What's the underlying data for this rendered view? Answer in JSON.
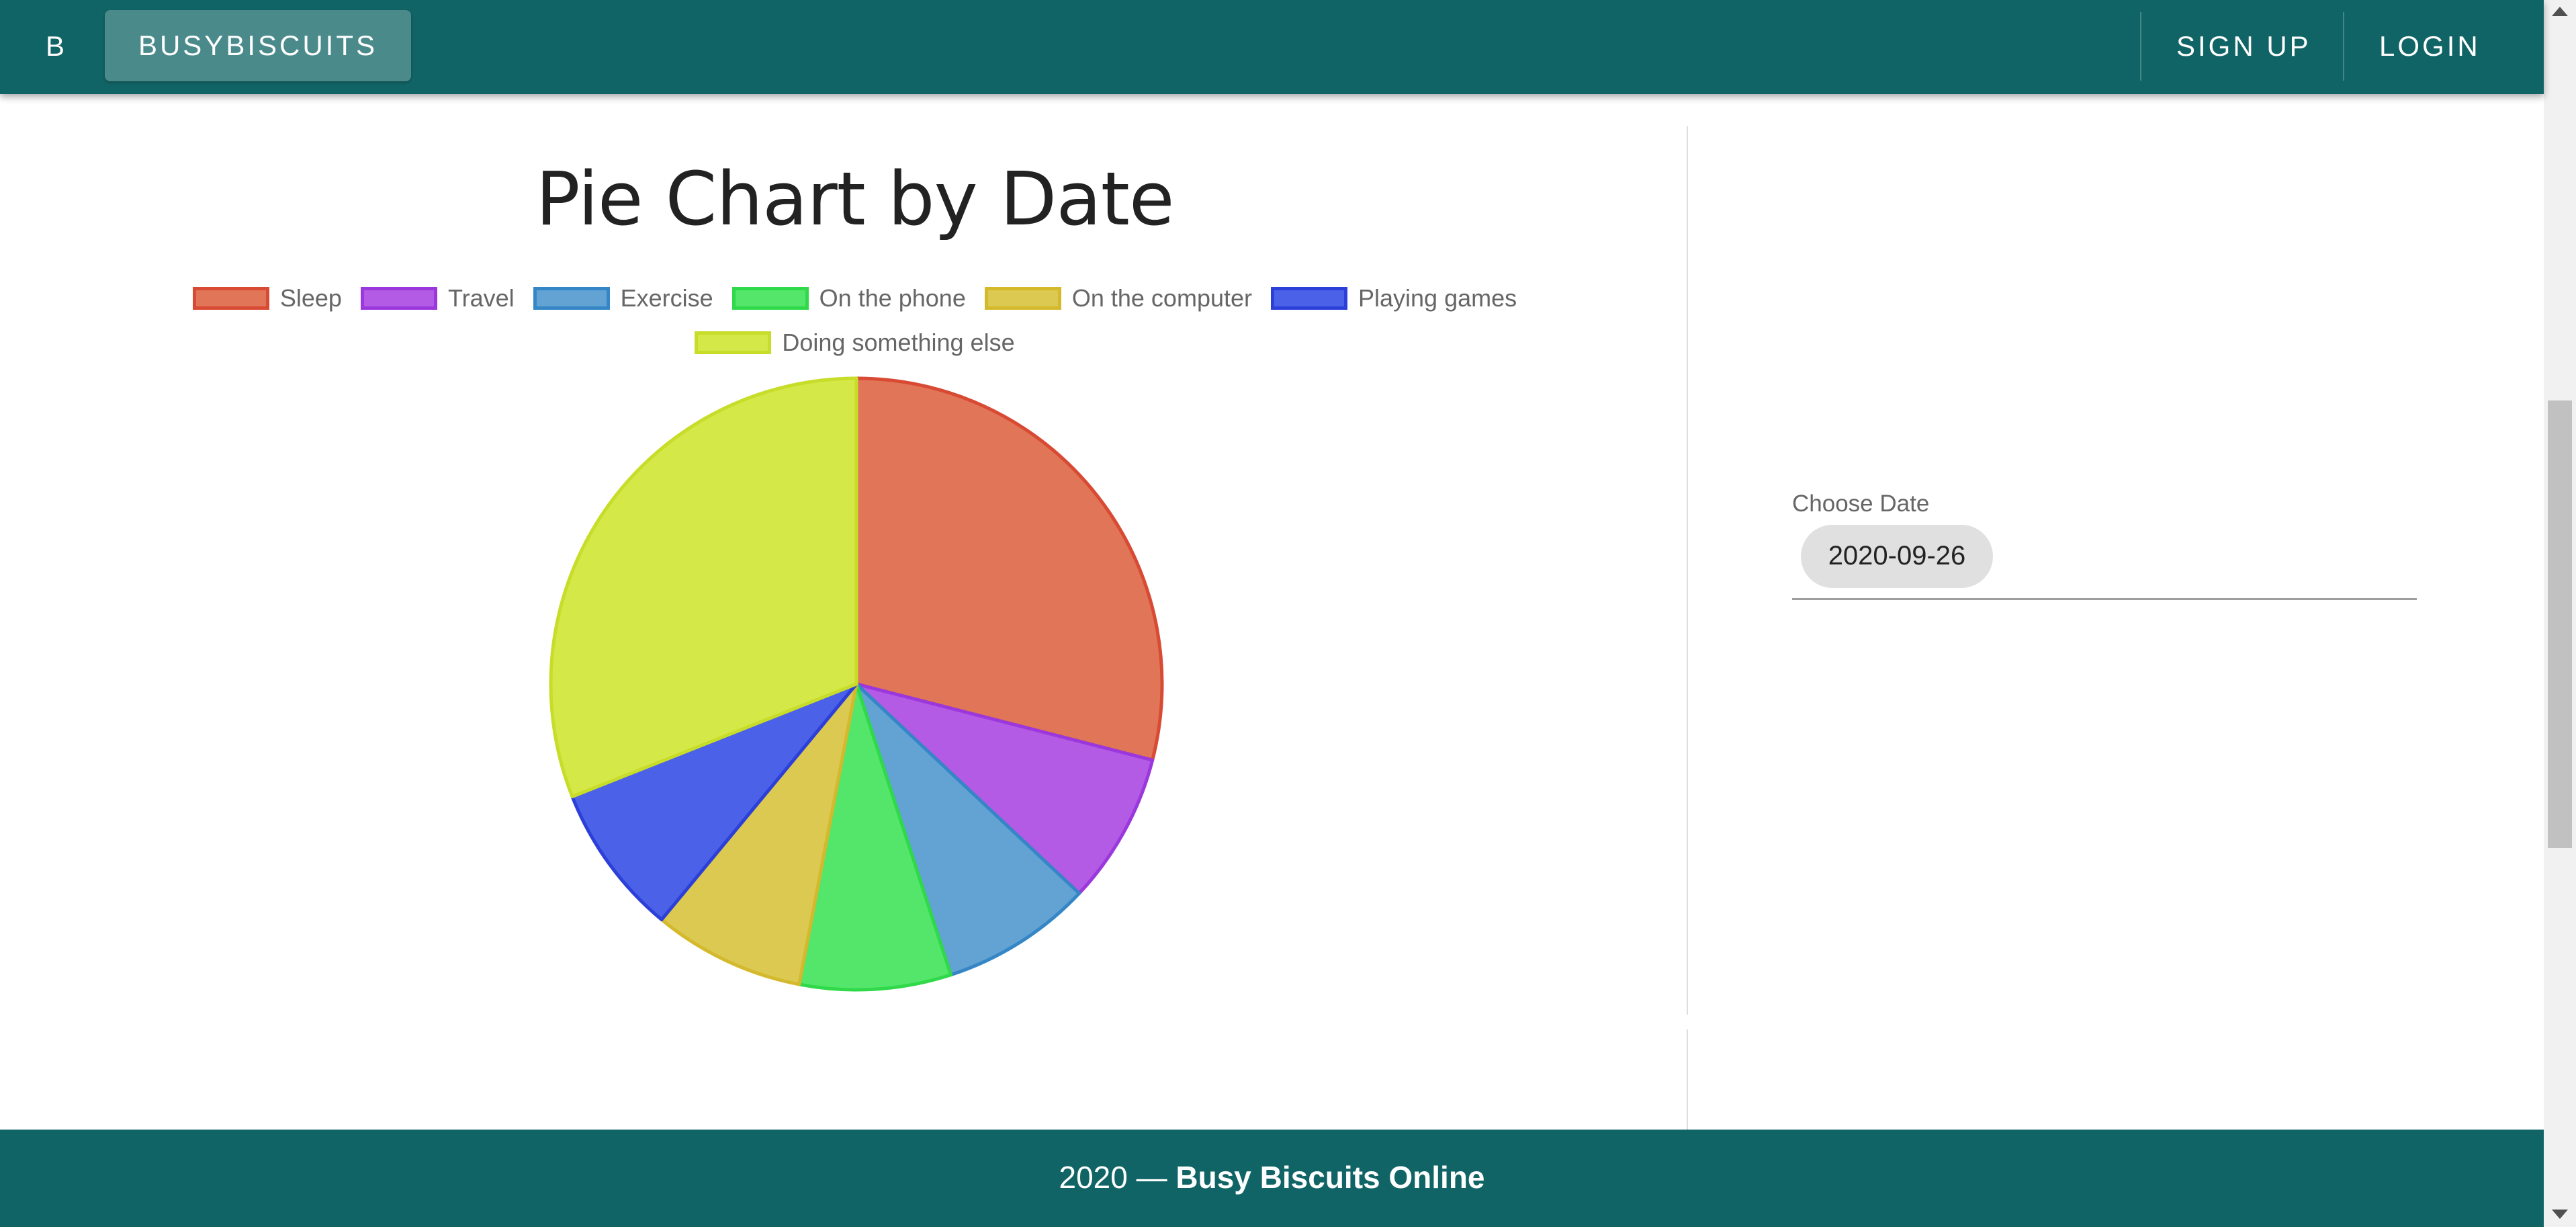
{
  "appbar": {
    "initial": "B",
    "brand": "BUSYBISCUITS",
    "signup": "SIGN UP",
    "login": "LOGIN",
    "color": "#116466"
  },
  "date_picker": {
    "label": "Choose Date",
    "value": "2020-09-26"
  },
  "footer": {
    "year": "2020 —",
    "name": "Busy Biscuits Online"
  },
  "chart_data": {
    "type": "pie",
    "title": "Pie Chart by Date",
    "legend_position": "top",
    "slices": [
      {
        "label": "Sleep",
        "value": 29,
        "fill": "#e07558",
        "stroke": "#d84a33"
      },
      {
        "label": "Travel",
        "value": 8,
        "fill": "#b45be5",
        "stroke": "#9b38dd"
      },
      {
        "label": "Exercise",
        "value": 8,
        "fill": "#62a3d4",
        "stroke": "#3586c6"
      },
      {
        "label": "On the phone",
        "value": 8,
        "fill": "#54e66a",
        "stroke": "#2fd94a"
      },
      {
        "label": "On the computer",
        "value": 8,
        "fill": "#dcc951",
        "stroke": "#d4b92d"
      },
      {
        "label": "Playing games",
        "value": 8,
        "fill": "#4b62e8",
        "stroke": "#2c3fd8"
      },
      {
        "label": "Doing something else",
        "value": 31,
        "fill": "#d4e847",
        "stroke": "#c7dd2a"
      }
    ]
  }
}
